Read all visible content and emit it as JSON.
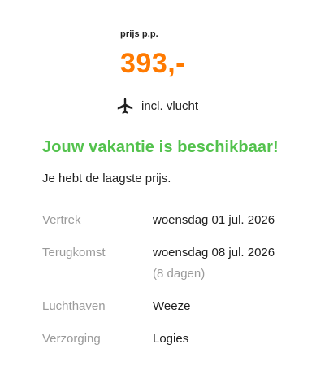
{
  "price": {
    "label": "prijs p.p.",
    "value": "393,-",
    "color": "#ff7a00"
  },
  "flight": {
    "icon": "airplane-icon",
    "text": "incl. vlucht"
  },
  "availability": {
    "headline": "Jouw vakantie is beschikbaar!",
    "headline_color": "#53c24d",
    "subline": "Je hebt de laagste prijs."
  },
  "details": [
    {
      "label": "Vertrek",
      "value": "woensdag 01 jul. 2026",
      "note": ""
    },
    {
      "label": "Terugkomst",
      "value": "woensdag 08 jul. 2026",
      "note": "(8 dagen)"
    },
    {
      "label": "Luchthaven",
      "value": "Weeze",
      "note": ""
    },
    {
      "label": "Verzorging",
      "value": "Logies",
      "note": ""
    }
  ]
}
